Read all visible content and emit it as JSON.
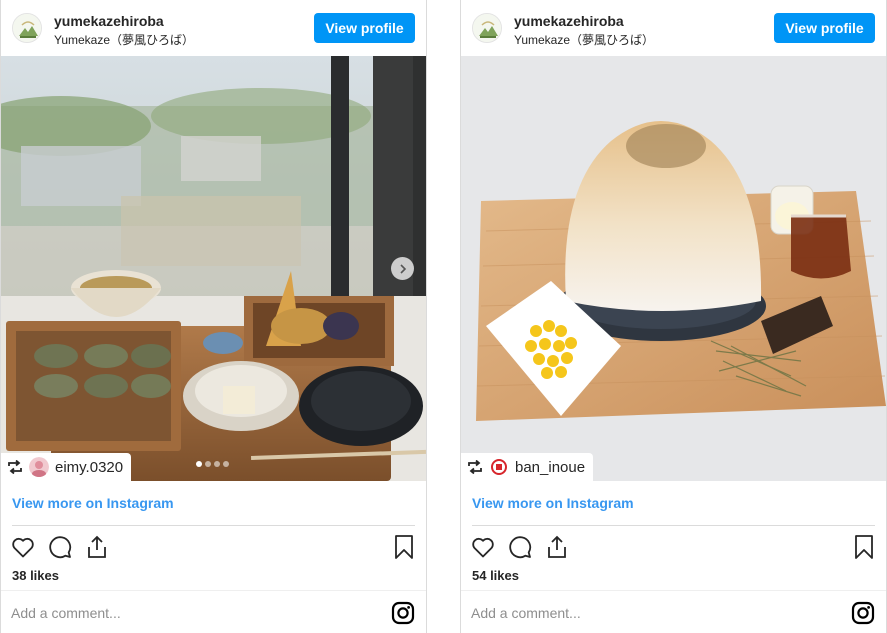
{
  "posts": [
    {
      "username": "yumekazehiroba",
      "full_name": "Yumekaze（夢風ひろば）",
      "view_profile_label": "View profile",
      "repost_user": "eimy.0320",
      "view_more_label": "View more on Instagram",
      "likes": "38 likes",
      "comment_placeholder": "Add a comment...",
      "carousel_pages": 4,
      "carousel_active": 1
    },
    {
      "username": "yumekazehiroba",
      "full_name": "Yumekaze（夢風ひろば）",
      "view_profile_label": "View profile",
      "repost_user": "ban_inoue",
      "view_more_label": "View more on Instagram",
      "likes": "54 likes",
      "comment_placeholder": "Add a comment..."
    }
  ],
  "colors": {
    "accent": "#0095f6",
    "link": "#3897f0",
    "border": "#dbdbdb"
  },
  "icons": [
    "heart-icon",
    "comment-icon",
    "share-icon",
    "bookmark-icon",
    "instagram-icon",
    "repost-icon",
    "chevron-right-icon"
  ]
}
